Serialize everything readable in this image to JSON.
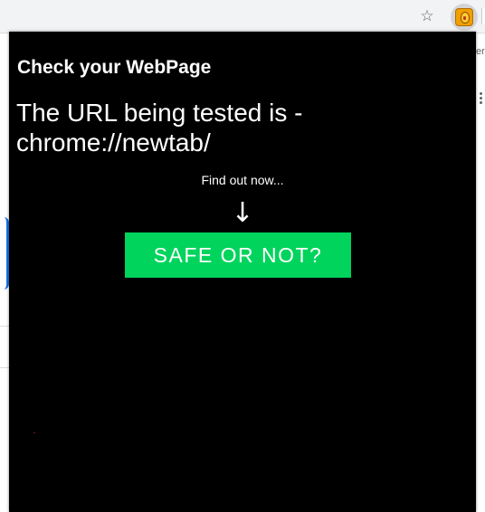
{
  "colors": {
    "popup_background": "#000000",
    "text": "#ffffff",
    "button_background": "#00d45c",
    "toolbar_background": "#f1f3f4"
  },
  "toolbar": {
    "bookmark_icon": "star-icon",
    "bookmark_glyph": "☆",
    "extension_icon": "extension-icon"
  },
  "background_page": {
    "partial_text": "er",
    "apps_icon": "apps-grid-icon"
  },
  "popup": {
    "title": "Check your WebPage",
    "url_label": "The URL being tested is -",
    "url": "chrome://newtab/",
    "prompt": "Find out now...",
    "arrow_icon": "down-arrow-icon",
    "arrow_glyph": "↓",
    "button_label": "SAFE OR NOT?"
  }
}
